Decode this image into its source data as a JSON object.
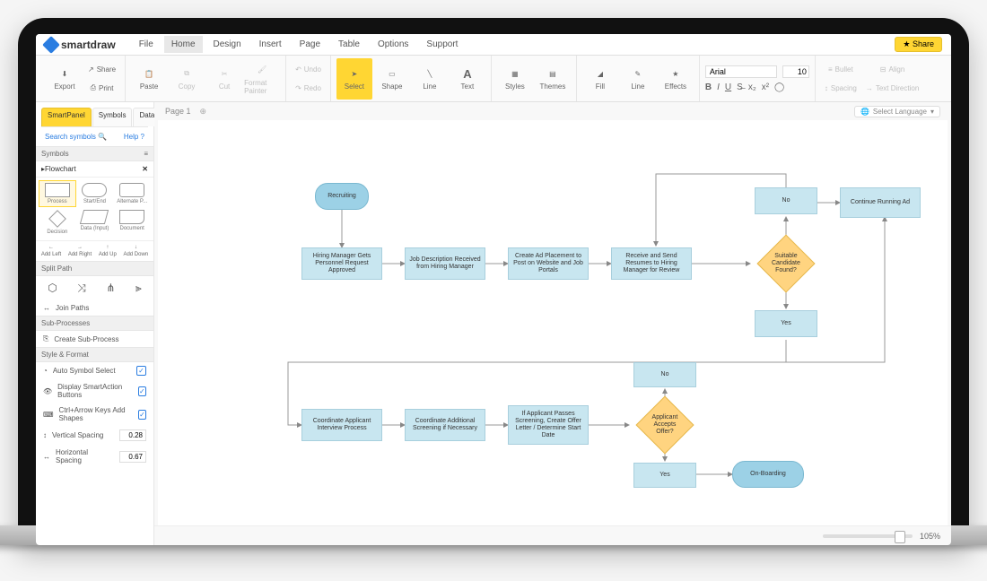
{
  "brand": "smartdraw",
  "menus": [
    "File",
    "Home",
    "Design",
    "Insert",
    "Page",
    "Table",
    "Options",
    "Support"
  ],
  "active_menu": "Home",
  "share_label": "Share",
  "ribbon": {
    "export": "Export",
    "share": "Share",
    "print": "Print",
    "paste": "Paste",
    "copy": "Copy",
    "cut": "Cut",
    "format_painter": "Format Painter",
    "undo": "Undo",
    "redo": "Redo",
    "select": "Select",
    "shape": "Shape",
    "line": "Line",
    "text": "Text",
    "styles": "Styles",
    "themes": "Themes",
    "fill": "Fill",
    "line2": "Line",
    "effects": "Effects",
    "font": "Arial",
    "fontsize": "10",
    "bullet": "Bullet",
    "align": "Align",
    "spacing": "Spacing",
    "direction": "Text Direction",
    "b": "B",
    "i": "I",
    "u": "U"
  },
  "side": {
    "tabs": [
      "SmartPanel",
      "Symbols",
      "Data"
    ],
    "search": "Search symbols",
    "help": "Help",
    "symbols_hdr": "Symbols",
    "category": "Flowchart",
    "shapes": [
      "Process",
      "Start/End",
      "Alternate P...",
      "Decision",
      "Data (Input)",
      "Document"
    ],
    "add": [
      "Add Left",
      "Add Right",
      "Add Up",
      "Add Down"
    ],
    "split_hdr": "Split Path",
    "join": "Join Paths",
    "sub_hdr": "Sub-Processes",
    "create_sub": "Create Sub-Process",
    "style_hdr": "Style & Format",
    "opts": [
      "Auto Symbol Select",
      "Display SmartAction Buttons",
      "Ctrl+Arrow Keys Add Shapes"
    ],
    "vspacing_lbl": "Vertical Spacing",
    "vspacing": "0.28",
    "hspacing_lbl": "Horizontal Spacing",
    "hspacing": "0.67"
  },
  "page_label": "Page 1",
  "lang_label": "Select Language",
  "zoom": "105%",
  "flow": {
    "recruiting": "Recruiting",
    "n1": "Hiring Manager Gets Personnel Request Approved",
    "n2": "Job Description Received from Hiring Manager",
    "n3": "Create Ad Placement to Post on Website and Job Portals",
    "n4": "Receive and Send Resumes to Hiring Manager for Review",
    "d1": "Suitable Candidate Found?",
    "no1": "No",
    "cont": "Continue Running Ad",
    "yes1": "Yes",
    "n5": "Coordinate Applicant Interview Process",
    "n6": "Coordinate Additional Screening if Necessary",
    "n7": "If Applicant Passes Screening, Create Offer Letter / Determine Start Date",
    "d2": "Applicant Accepts Offer?",
    "no2": "No",
    "yes2": "Yes",
    "onboard": "On-Boarding"
  }
}
